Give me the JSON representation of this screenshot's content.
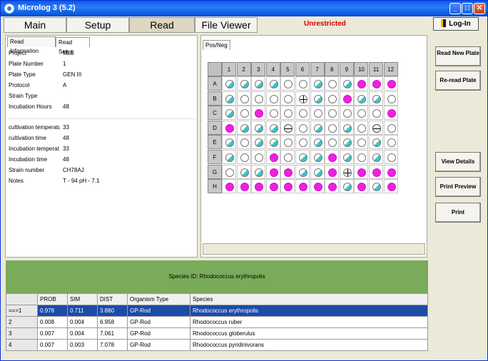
{
  "window": {
    "title": "Microlog 3 (5.2)"
  },
  "top_tabs": [
    {
      "label": "Main",
      "active": false
    },
    {
      "label": "Setup",
      "active": false
    },
    {
      "label": "Read",
      "active": true
    },
    {
      "label": "File Viewer",
      "active": false
    }
  ],
  "status": {
    "unrestricted": "Unrestricted"
  },
  "login": {
    "label": "Log-In"
  },
  "info_tabs": [
    "Read Information",
    "Read Setup"
  ],
  "plate_info": [
    {
      "label": "Project",
      "value": "ML5"
    },
    {
      "label": "Plate Number",
      "value": "1"
    },
    {
      "label": "Plate Type",
      "value": "GEN III"
    },
    {
      "label": "Protocol",
      "value": "A"
    },
    {
      "label": "Strain Type",
      "value": ""
    },
    {
      "label": "Incubation Hours",
      "value": "48"
    }
  ],
  "extra_info": [
    {
      "label": "cultivation temperatu",
      "value": "33"
    },
    {
      "label": "cultivation time",
      "value": "48"
    },
    {
      "label": "Incubation temperat",
      "value": "33"
    },
    {
      "label": "Incubation time",
      "value": "48"
    },
    {
      "label": "Strain number",
      "value": "CH78AJ"
    },
    {
      "label": "Notes",
      "value": "T - 94 pH - 7.1"
    }
  ],
  "plate_tab": "Pos/Neg",
  "plate": {
    "columns": [
      "1",
      "2",
      "3",
      "4",
      "5",
      "6",
      "7",
      "8",
      "9",
      "10",
      "11",
      "12"
    ],
    "rows": [
      {
        "label": "A",
        "wells": [
          "half",
          "half",
          "half",
          "half",
          "neg",
          "neg",
          "half",
          "neg",
          "half",
          "pos",
          "pos",
          "pos"
        ]
      },
      {
        "label": "B",
        "wells": [
          "half",
          "neg",
          "neg",
          "neg",
          "neg",
          "cross",
          "half",
          "neg",
          "pos",
          "half",
          "half",
          "neg"
        ]
      },
      {
        "label": "C",
        "wells": [
          "half",
          "neg",
          "pos",
          "neg",
          "neg",
          "neg",
          "neg",
          "neg",
          "neg",
          "neg",
          "neg",
          "pos"
        ]
      },
      {
        "label": "D",
        "wells": [
          "pos",
          "half",
          "half",
          "half",
          "border",
          "neg",
          "half",
          "neg",
          "half",
          "neg",
          "border",
          "neg"
        ]
      },
      {
        "label": "E",
        "wells": [
          "half",
          "neg",
          "half",
          "half",
          "neg",
          "neg",
          "half",
          "neg",
          "half",
          "neg",
          "half",
          "neg"
        ]
      },
      {
        "label": "F",
        "wells": [
          "half",
          "neg",
          "neg",
          "pos",
          "neg",
          "half",
          "half",
          "pos",
          "half",
          "neg",
          "half",
          "neg"
        ]
      },
      {
        "label": "G",
        "wells": [
          "neg",
          "half",
          "half",
          "pos",
          "pos",
          "half",
          "half",
          "pos",
          "cross",
          "pos",
          "pos",
          "pos"
        ]
      },
      {
        "label": "H",
        "wells": [
          "pos",
          "pos",
          "pos",
          "pos",
          "pos",
          "pos",
          "pos",
          "pos",
          "half",
          "pos",
          "half",
          "pos"
        ]
      }
    ]
  },
  "right_buttons": {
    "read_new": "Read New Plate",
    "reread": "Re-read Plate",
    "view_details": "View Details",
    "print_preview": "Print Preview",
    "print": "Print"
  },
  "species_banner": "Species ID: Rhodococcus erythropolis",
  "results": {
    "headers": [
      "",
      "PROB",
      "SIM",
      "DIST",
      "Organism Type",
      "Species"
    ],
    "rows": [
      {
        "id": "==>1",
        "prob": "0.978",
        "sim": "0.711",
        "dist": "3.880",
        "type": "GP-Rod",
        "species": "Rhodococcus erythropolis",
        "selected": true
      },
      {
        "id": "2",
        "prob": "0.008",
        "sim": "0.004",
        "dist": "6.958",
        "type": "GP-Rod",
        "species": "Rhodococcus ruber",
        "selected": false
      },
      {
        "id": "3",
        "prob": "0.007",
        "sim": "0.004",
        "dist": "7.061",
        "type": "GP-Rod",
        "species": "Rhodococcus globerulus",
        "selected": false
      },
      {
        "id": "4",
        "prob": "0.007",
        "sim": "0.003",
        "dist": "7.078",
        "type": "GP-Rod",
        "species": "Rhodococcus pyridinivorans",
        "selected": false
      }
    ]
  }
}
